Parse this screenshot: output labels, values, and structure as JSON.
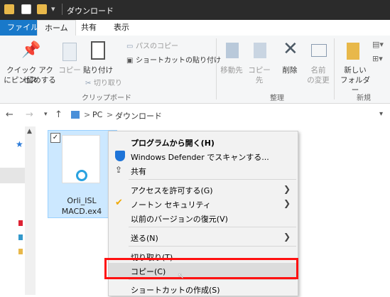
{
  "window": {
    "title": "ダウンロード"
  },
  "ribbon": {
    "tabs": [
      {
        "label": "ファイル"
      },
      {
        "label": "ホーム"
      },
      {
        "label": "共有"
      },
      {
        "label": "表示"
      }
    ],
    "clipboard": {
      "pin_label_1": "クイック アクセス",
      "pin_label_2": "にピン留めする",
      "copy_label": "コピー",
      "paste_label": "貼り付け",
      "copy_path_label": "パスのコピー",
      "paste_shortcut_label": "ショートカットの貼り付け",
      "cut_label": "切り取り",
      "group_label": "クリップボード"
    },
    "organize": {
      "move_label_1": "移動先",
      "copy_to_label_1": "コピー先",
      "delete_label": "削除",
      "rename_label_1": "名前",
      "rename_label_2": "の変更",
      "group_label": "整理"
    },
    "new": {
      "new_folder_1": "新しい",
      "new_folder_2": "フォルダー",
      "group_label": "新規"
    }
  },
  "address": {
    "root": "PC",
    "current": "ダウンロード",
    "separator": ">"
  },
  "file": {
    "name_line1": "Orli_ISL",
    "name_line2": "MACD.ex4"
  },
  "context_menu": {
    "items": [
      {
        "label": "プログラムから開く(H)"
      },
      {
        "label": "Windows Defender でスキャンする..."
      },
      {
        "label": "共有"
      },
      {
        "label": "アクセスを許可する(G)"
      },
      {
        "label": "ノートン セキュリティ"
      },
      {
        "label": "以前のバージョンの復元(V)"
      },
      {
        "label": "送る(N)"
      },
      {
        "label": "切り取り(T)"
      },
      {
        "label": "コピー(C)"
      },
      {
        "label": "ショートカットの作成(S)"
      }
    ],
    "highlight_color": "#ff1111"
  }
}
